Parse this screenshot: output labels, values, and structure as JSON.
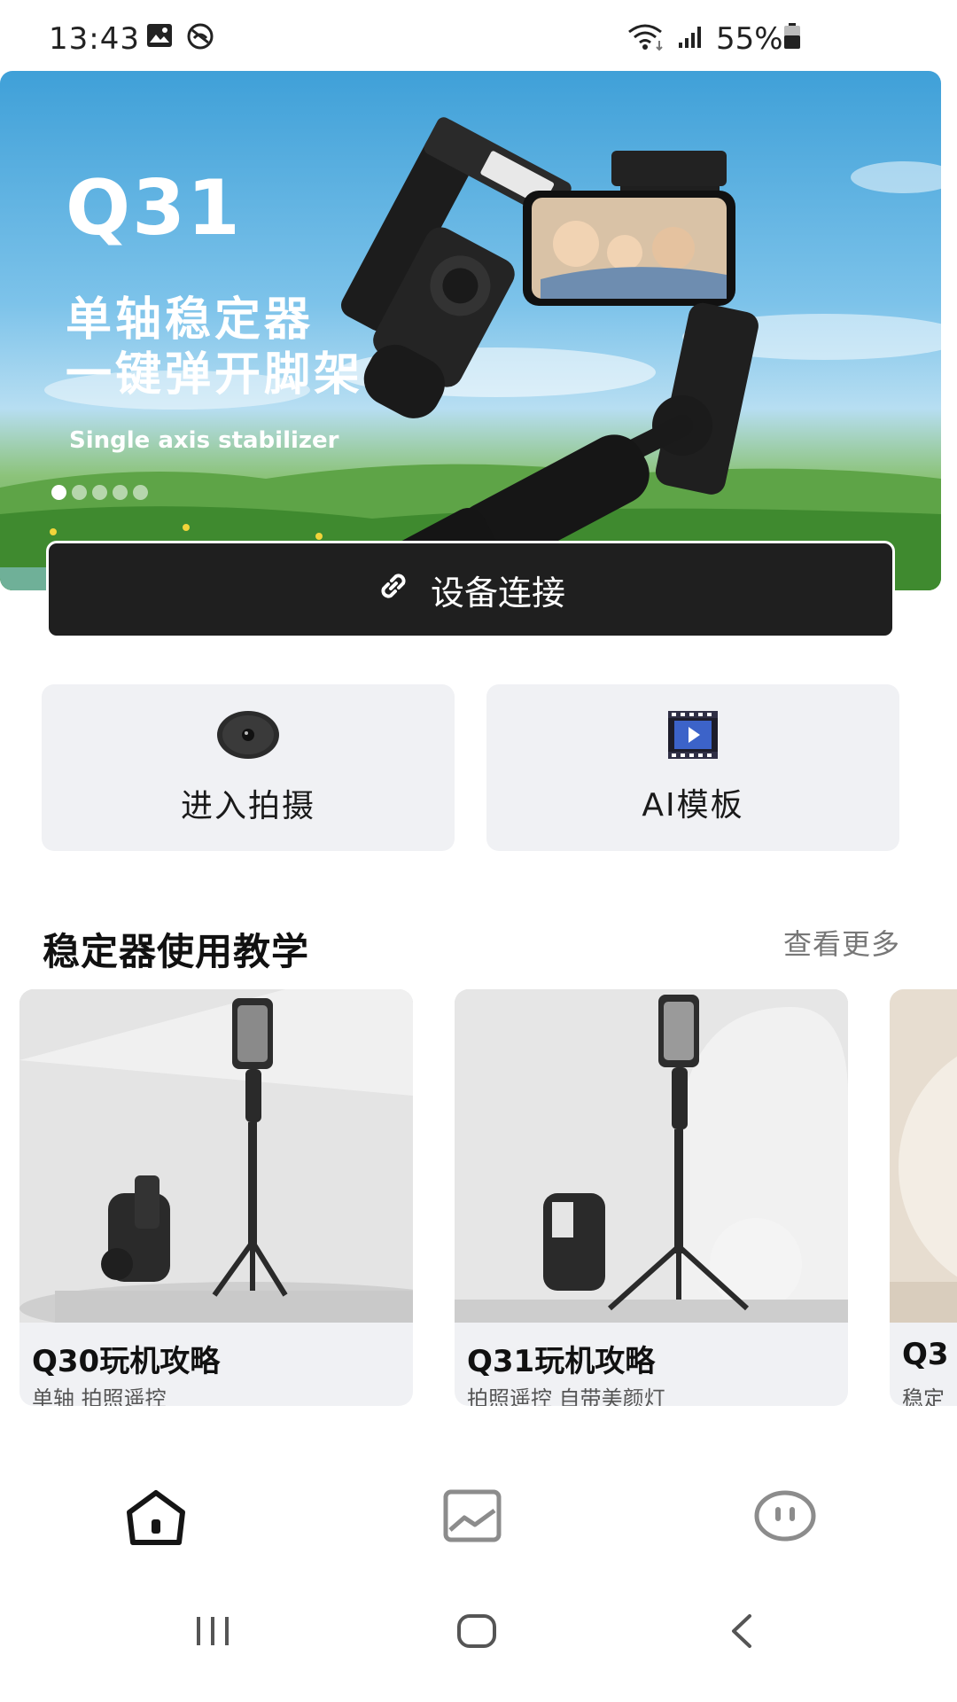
{
  "status_bar": {
    "time": "13:43",
    "battery": "55%",
    "icons": [
      "image-icon",
      "blocked-icon",
      "wifi-icon",
      "signal-icon",
      "battery-icon"
    ]
  },
  "banner": {
    "title": "Q31",
    "line1": "单轴稳定器",
    "line2": "一键弹开脚架",
    "subtitle": "Single axis stabilizer",
    "slide_count": 5,
    "active_slide": 1
  },
  "connect_button": {
    "label": "设备连接",
    "icon": "link-icon"
  },
  "actions": [
    {
      "label": "进入拍摄",
      "icon": "camera-lens-icon"
    },
    {
      "label": "AI模板",
      "icon": "video-clapper-icon"
    }
  ],
  "tutorials": {
    "title": "稳定器使用教学",
    "see_more": "查看更多",
    "cards": [
      {
        "title": "Q30玩机攻略",
        "subtitle": "单轴 拍照遥控"
      },
      {
        "title": "Q31玩机攻略",
        "subtitle": "拍照遥控 自带美颜灯"
      },
      {
        "title": "Q3",
        "subtitle": "稳定"
      }
    ]
  },
  "bottom_nav": {
    "items": [
      {
        "name": "home",
        "icon": "home-icon",
        "active": true
      },
      {
        "name": "gallery",
        "icon": "gallery-icon",
        "active": false
      },
      {
        "name": "profile",
        "icon": "face-icon",
        "active": false
      }
    ]
  },
  "colors": {
    "connect_bg": "#1f1f1f",
    "tile_bg": "#f0f1f4",
    "text": "#1a1a1a",
    "muted": "#777777"
  }
}
